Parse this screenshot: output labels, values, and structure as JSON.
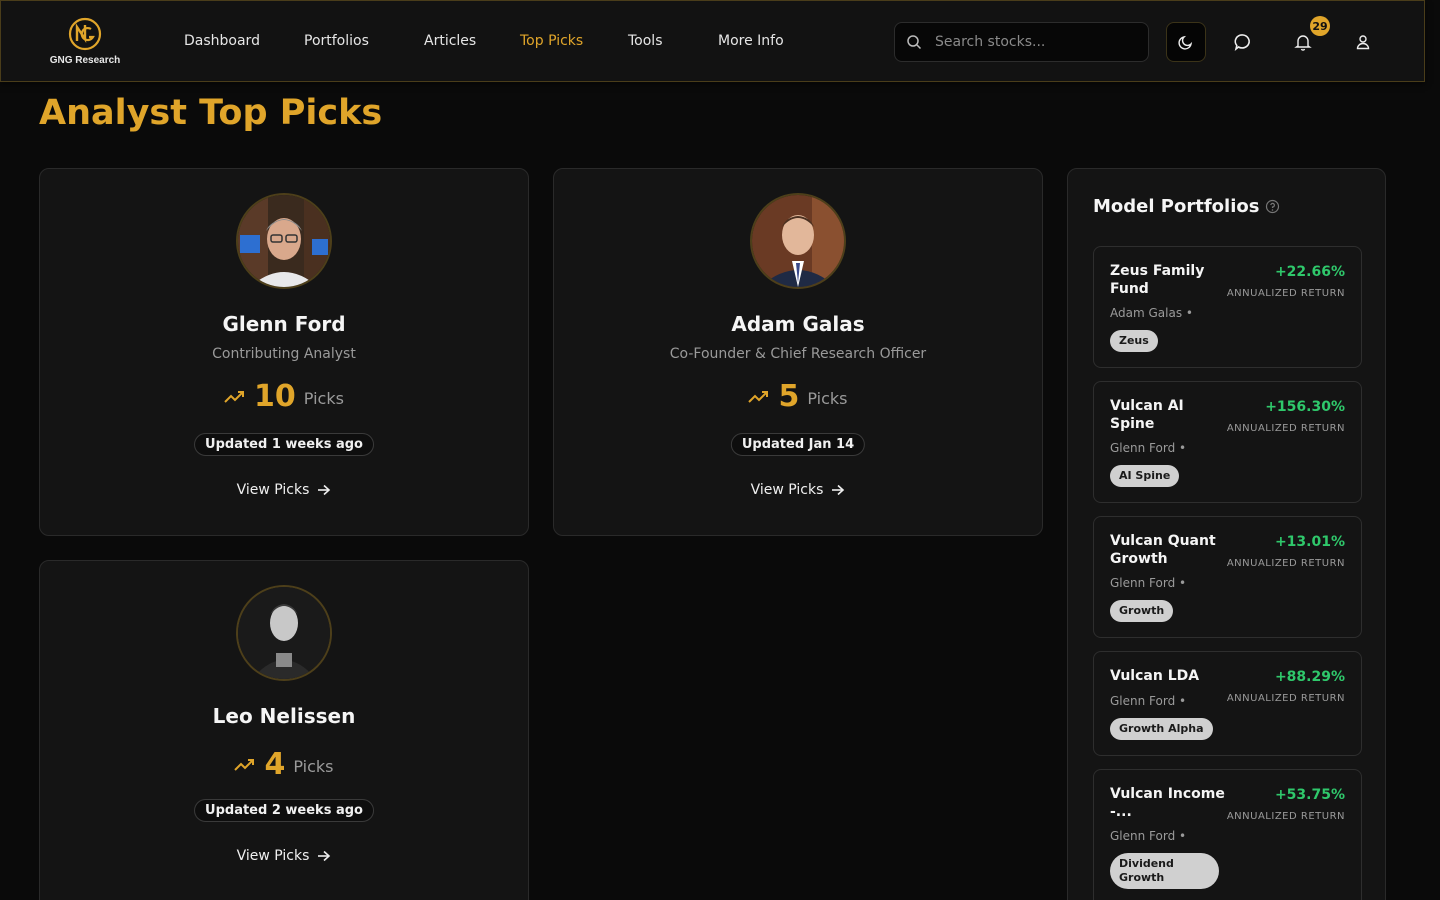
{
  "brand": {
    "name": "GNG Research",
    "accent": "#e0a52a"
  },
  "nav": {
    "items": [
      {
        "label": "Dashboard",
        "active": false
      },
      {
        "label": "Portfolios",
        "active": false
      },
      {
        "label": "Articles",
        "active": false
      },
      {
        "label": "Top Picks",
        "active": true
      },
      {
        "label": "Tools",
        "active": false
      },
      {
        "label": "More Info",
        "active": false
      }
    ]
  },
  "search": {
    "placeholder": "Search stocks..."
  },
  "notifications": {
    "count": "29"
  },
  "page": {
    "title": "Analyst Top Picks"
  },
  "analysts": [
    {
      "name": "Glenn Ford",
      "role": "Contributing Analyst",
      "picks": "10",
      "picks_label": "Picks",
      "updated": "Updated 1 weeks ago",
      "view": "View Picks"
    },
    {
      "name": "Adam Galas",
      "role": "Co-Founder & Chief Research Officer",
      "picks": "5",
      "picks_label": "Picks",
      "updated": "Updated Jan 14",
      "view": "View Picks"
    },
    {
      "name": "Leo Nelissen",
      "role": "",
      "picks": "4",
      "picks_label": "Picks",
      "updated": "Updated 2 weeks ago",
      "view": "View Picks"
    }
  ],
  "model_portfolios": {
    "title": "Model Portfolios",
    "return_label": "ANNUALIZED RETURN",
    "items": [
      {
        "name": "Zeus Family Fund",
        "author": "Adam Galas  •",
        "return": "+22.66%",
        "tag": "Zeus"
      },
      {
        "name": "Vulcan AI Spine",
        "author": "Glenn Ford  •",
        "return": "+156.30%",
        "tag": "AI Spine"
      },
      {
        "name": "Vulcan Quant Growth",
        "author": "Glenn Ford  •",
        "return": "+13.01%",
        "tag": "Growth"
      },
      {
        "name": "Vulcan LDA",
        "author": "Glenn Ford  •",
        "return": "+88.29%",
        "tag": "Growth Alpha"
      },
      {
        "name": "Vulcan Income -...",
        "author": "Glenn Ford  •",
        "return": "+53.75%",
        "tag": "Dividend Growth"
      }
    ]
  }
}
